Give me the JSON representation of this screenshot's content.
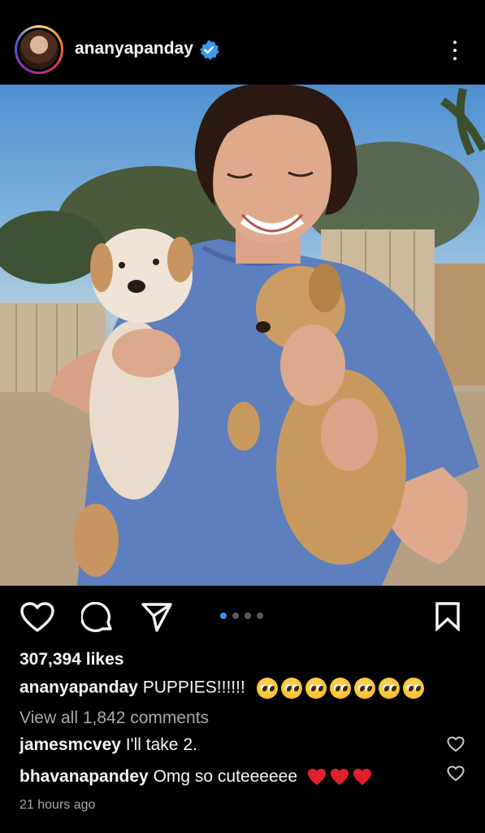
{
  "header": {
    "username": "ananyapanday",
    "verified": true,
    "more_icon": "more-vertical-icon"
  },
  "post": {
    "image_description_icon": "post-photo",
    "carousel": {
      "total": 4,
      "active": 1
    },
    "likes_text": "307,394 likes",
    "caption_user": "ananyapanday",
    "caption_text": "PUPPIES!!!!!!",
    "caption_emoji_count": 7,
    "view_all_comments": "View all 1,842 comments",
    "comments": [
      {
        "user": "jamesmcvey",
        "text": "I'll take 2.",
        "hearts": 0
      },
      {
        "user": "bhavanapandey",
        "text": "Omg so cuteeeeee",
        "hearts": 3
      }
    ],
    "timestamp": "21 hours ago"
  },
  "colors": {
    "accent": "#3897f0",
    "heart": "#e0202c",
    "muted": "#a8a8a8"
  }
}
